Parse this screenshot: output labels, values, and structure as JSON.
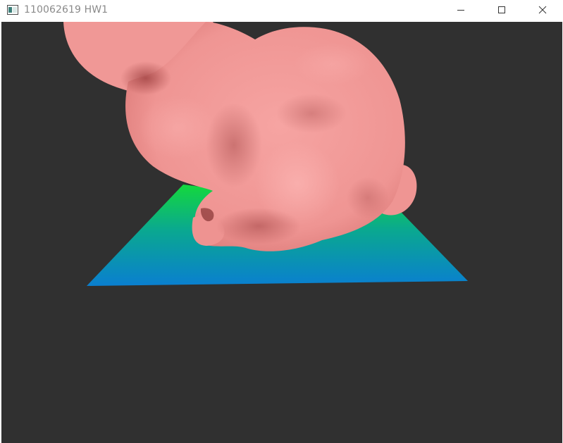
{
  "window": {
    "title": "110062619 HW1",
    "icons": {
      "app": "opengl-window-app-icon",
      "minimize": "minimize-icon",
      "maximize": "maximize-icon",
      "close": "close-icon"
    }
  },
  "scene": {
    "background_color": "#303030",
    "model": "bunny",
    "model_color": "#f29a98",
    "ground_plane": {
      "gradient_top_color": "#14d83c",
      "gradient_bottom_color": "#0a7fd0"
    }
  }
}
